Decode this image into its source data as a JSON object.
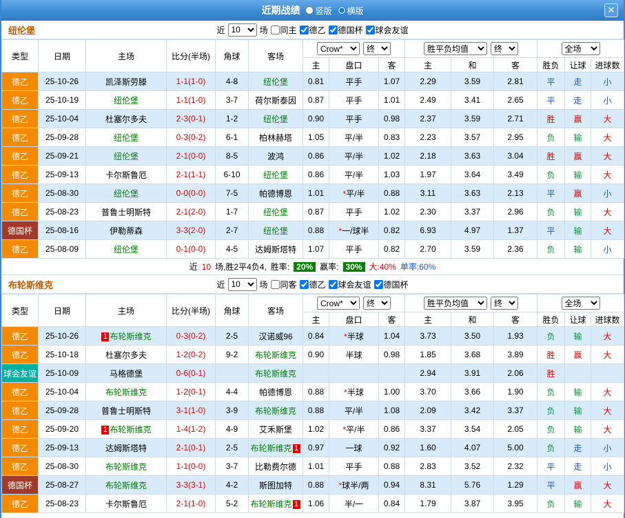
{
  "topbar": {
    "title": "近期战绩",
    "radios": [
      {
        "label": "竖版",
        "checked": false
      },
      {
        "label": "横版",
        "checked": true
      }
    ],
    "close_icon": "✕"
  },
  "type_colors": {
    "德乙": "#f38a00",
    "德国杯": "#a03a2a",
    "球会友谊": "#00b0a0"
  },
  "result_colors": {
    "胜": "#e60000",
    "赢": "#e60000",
    "大": "#e60000",
    "平": "#1a56db",
    "走": "#1a56db",
    "小": "#1a56db",
    "负": "#009933",
    "输": "#009933"
  },
  "sections": [
    {
      "team": "纽伦堡",
      "filter": {
        "near": "近",
        "count": "10",
        "games": "场",
        "same": {
          "label": "同主",
          "checked": false
        },
        "leagues": [
          {
            "label": "德乙",
            "checked": true
          },
          {
            "label": "德国杯",
            "checked": true
          },
          {
            "label": "球会友谊",
            "checked": true
          }
        ]
      },
      "selects": {
        "company": "Crow*",
        "final_a": "终",
        "avg": "胜平负均值",
        "final_b": "终",
        "scope": "全场"
      },
      "headers": [
        "类型",
        "日期",
        "主场",
        "比分(半场)",
        "角球",
        "客场",
        "主",
        "盘口",
        "客",
        "主",
        "和",
        "客",
        "胜负",
        "让球",
        "进球数"
      ],
      "rows": [
        {
          "type": "德乙",
          "date": "25-10-26",
          "home": "凯泽斯劳滕",
          "score": "1-1(1-0)",
          "corner": "4-8",
          "away": "纽伦堡",
          "focus": "away",
          "h": "0.81",
          "line": "平手",
          "a": "1.07",
          "w": "2.29",
          "d": "3.59",
          "l": "2.81",
          "res": "平",
          "ah": "走",
          "ou": "小"
        },
        {
          "type": "德乙",
          "date": "25-10-19",
          "home": "纽伦堡",
          "score": "1-1(1-0)",
          "corner": "3-7",
          "away": "荷尔斯泰因",
          "focus": "home",
          "h": "0.87",
          "line": "平手",
          "a": "1.01",
          "w": "2.49",
          "d": "3.41",
          "l": "2.65",
          "res": "平",
          "ah": "走",
          "ou": "小"
        },
        {
          "type": "德乙",
          "date": "25-10-04",
          "home": "杜塞尔多夫",
          "score": "2-3(0-1)",
          "corner": "1-2",
          "away": "纽伦堡",
          "focus": "away",
          "h": "0.90",
          "line": "平手",
          "a": "0.98",
          "w": "2.37",
          "d": "3.59",
          "l": "2.71",
          "res": "胜",
          "ah": "赢",
          "ou": "大"
        },
        {
          "type": "德乙",
          "date": "25-09-28",
          "home": "纽伦堡",
          "score": "0-3(0-2)",
          "corner": "6-1",
          "away": "柏林赫塔",
          "focus": "home",
          "h": "1.05",
          "line": "平/半",
          "a": "0.83",
          "w": "2.23",
          "d": "3.57",
          "l": "2.95",
          "res": "负",
          "ah": "输",
          "ou": "大"
        },
        {
          "type": "德乙",
          "date": "25-09-21",
          "home": "纽伦堡",
          "score": "2-1(0-0)",
          "corner": "8-5",
          "away": "波鸿",
          "focus": "home",
          "h": "0.86",
          "line": "平/半",
          "a": "1.02",
          "w": "2.18",
          "d": "3.63",
          "l": "3.04",
          "res": "胜",
          "ah": "赢",
          "ou": "大"
        },
        {
          "type": "德乙",
          "date": "25-09-13",
          "home": "卡尔斯鲁厄",
          "score": "2-1(1-1)",
          "corner": "6-10",
          "away": "纽伦堡",
          "focus": "away",
          "h": "0.86",
          "line": "平/半",
          "a": "1.03",
          "w": "1.97",
          "d": "3.64",
          "l": "3.49",
          "res": "负",
          "ah": "输",
          "ou": "大"
        },
        {
          "type": "德乙",
          "date": "25-08-30",
          "home": "纽伦堡",
          "score": "0-0(0-0)",
          "corner": "7-5",
          "away": "帕德博恩",
          "focus": "home",
          "h": "1.01",
          "line": "*平/半",
          "a": "0.88",
          "w": "3.11",
          "d": "3.63",
          "l": "2.13",
          "res": "平",
          "ah": "赢",
          "ou": "小"
        },
        {
          "type": "德乙",
          "date": "25-08-23",
          "home": "普鲁士明斯特",
          "score": "2-1(2-0)",
          "corner": "1-7",
          "away": "纽伦堡",
          "focus": "away",
          "h": "0.87",
          "line": "平手",
          "a": "1.02",
          "w": "2.30",
          "d": "3.37",
          "l": "2.96",
          "res": "负",
          "ah": "输",
          "ou": "大"
        },
        {
          "type": "德国杯",
          "date": "25-08-16",
          "home": "伊勒蒂森",
          "score": "3-3(2-0)",
          "corner": "2-7",
          "away": "纽伦堡",
          "focus": "away",
          "h": "0.88",
          "line": "*一/球半",
          "a": "0.82",
          "w": "6.93",
          "d": "4.97",
          "l": "1.37",
          "res": "平",
          "ah": "输",
          "ou": "大"
        },
        {
          "type": "德乙",
          "date": "25-08-09",
          "home": "纽伦堡",
          "score": "0-1(0-0)",
          "corner": "4-5",
          "away": "达姆斯塔特",
          "focus": "home",
          "h": "1.07",
          "line": "平手",
          "a": "0.82",
          "w": "2.70",
          "d": "3.59",
          "l": "2.36",
          "res": "负",
          "ah": "输",
          "ou": "小"
        }
      ],
      "summary": {
        "near": "近",
        "count": "10",
        "desc": "场,胜2平4负4,",
        "win_rate_label": "胜率:",
        "win_rate": "20%",
        "asian_rate_label": "赢率:",
        "asian_rate": "30%",
        "big_rate": "大:40%",
        "odd_rate": "单率:60%"
      }
    },
    {
      "team": "布轮斯维克",
      "filter": {
        "near": "近",
        "count": "10",
        "games": "场",
        "same": {
          "label": "同客",
          "checked": false
        },
        "leagues": [
          {
            "label": "德乙",
            "checked": true
          },
          {
            "label": "球会友谊",
            "checked": true
          },
          {
            "label": "德国杯",
            "checked": true
          }
        ]
      },
      "selects": {
        "company": "Crow*",
        "final_a": "终",
        "avg": "胜平负均值",
        "final_b": "终",
        "scope": "全场"
      },
      "headers": [
        "类型",
        "日期",
        "主场",
        "比分(半场)",
        "角球",
        "客场",
        "主",
        "盘口",
        "客",
        "主",
        "和",
        "客",
        "胜负",
        "让球",
        "进球数"
      ],
      "rows": [
        {
          "type": "德乙",
          "date": "25-10-26",
          "home": "布轮斯维克",
          "home_badge": "1",
          "score": "0-3(0-2)",
          "corner": "2-5",
          "away": "汉诺威96",
          "focus": "home",
          "h": "0.84",
          "line": "*半球",
          "a": "1.04",
          "w": "3.73",
          "d": "3.50",
          "l": "1.93",
          "res": "负",
          "ah": "输",
          "ou": "大"
        },
        {
          "type": "德乙",
          "date": "25-10-18",
          "home": "杜塞尔多夫",
          "score": "1-2(0-2)",
          "corner": "9-2",
          "away": "布轮斯维克",
          "focus": "away",
          "h": "0.90",
          "line": "半球",
          "a": "0.98",
          "w": "1.85",
          "d": "3.68",
          "l": "3.89",
          "res": "胜",
          "ah": "赢",
          "ou": "大"
        },
        {
          "type": "球会友谊",
          "date": "25-10-09",
          "home": "马格德堡",
          "score": "0-6(0-1)",
          "corner": "",
          "away": "布轮斯维克",
          "focus": "away",
          "h": "",
          "line": "",
          "a": "",
          "w": "2.94",
          "d": "3.91",
          "l": "2.06",
          "res": "胜",
          "ah": "",
          "ou": ""
        },
        {
          "type": "德乙",
          "date": "25-10-04",
          "home": "布轮斯维克",
          "score": "1-2(0-1)",
          "corner": "4-4",
          "away": "帕德博恩",
          "focus": "home",
          "h": "0.88",
          "line": "*半球",
          "a": "1.00",
          "w": "3.70",
          "d": "3.66",
          "l": "1.90",
          "res": "负",
          "ah": "输",
          "ou": "大"
        },
        {
          "type": "德乙",
          "date": "25-09-28",
          "home": "普鲁士明斯特",
          "score": "3-1(1-0)",
          "corner": "3-9",
          "away": "布轮斯维克",
          "focus": "away",
          "h": "0.88",
          "line": "平/半",
          "a": "1.08",
          "w": "2.09",
          "d": "3.42",
          "l": "3.37",
          "res": "负",
          "ah": "输",
          "ou": "大"
        },
        {
          "type": "德乙",
          "date": "25-09-20",
          "home": "布轮斯维克",
          "home_badge": "1",
          "score": "1-4(1-2)",
          "corner": "4-9",
          "away": "艾禾斯堡",
          "focus": "home",
          "h": "1.02",
          "line": "*平/半",
          "a": "0.86",
          "w": "3.37",
          "d": "3.54",
          "l": "2.05",
          "res": "负",
          "ah": "输",
          "ou": "大"
        },
        {
          "type": "德乙",
          "date": "25-09-13",
          "home": "达姆斯塔特",
          "score": "2-1(0-1)",
          "corner": "2-5",
          "away": "布轮斯维克",
          "away_badge": "1",
          "focus": "away",
          "h": "0.97",
          "line": "一球",
          "a": "0.92",
          "w": "1.60",
          "d": "4.07",
          "l": "5.00",
          "res": "负",
          "ah": "走",
          "ou": "小"
        },
        {
          "type": "德乙",
          "date": "25-08-30",
          "home": "布轮斯维克",
          "score": "1-1(0-0)",
          "corner": "3-7",
          "away": "比勒费尔德",
          "focus": "home",
          "h": "1.01",
          "line": "平手",
          "a": "0.88",
          "w": "2.83",
          "d": "3.52",
          "l": "2.32",
          "res": "平",
          "ah": "走",
          "ou": "小"
        },
        {
          "type": "德国杯",
          "date": "25-08-27",
          "home": "布轮斯维克",
          "score": "3-3(3-1)",
          "corner": "4-2",
          "away": "斯图加特",
          "focus": "home",
          "h": "0.88",
          "line": "*球半/两",
          "a": "0.94",
          "w": "8.31",
          "d": "5.76",
          "l": "1.29",
          "res": "平",
          "ah": "赢",
          "ou": "大"
        },
        {
          "type": "德乙",
          "date": "25-08-23",
          "home": "卡尔斯鲁厄",
          "score": "2-1(1-0)",
          "corner": "5-2",
          "away": "布轮斯维克",
          "away_badge": "1",
          "focus": "away",
          "h": "1.06",
          "line": "半/一",
          "a": "0.84",
          "w": "1.79",
          "d": "3.87",
          "l": "3.95",
          "res": "负",
          "ah": "输",
          "ou": "大"
        }
      ]
    }
  ]
}
